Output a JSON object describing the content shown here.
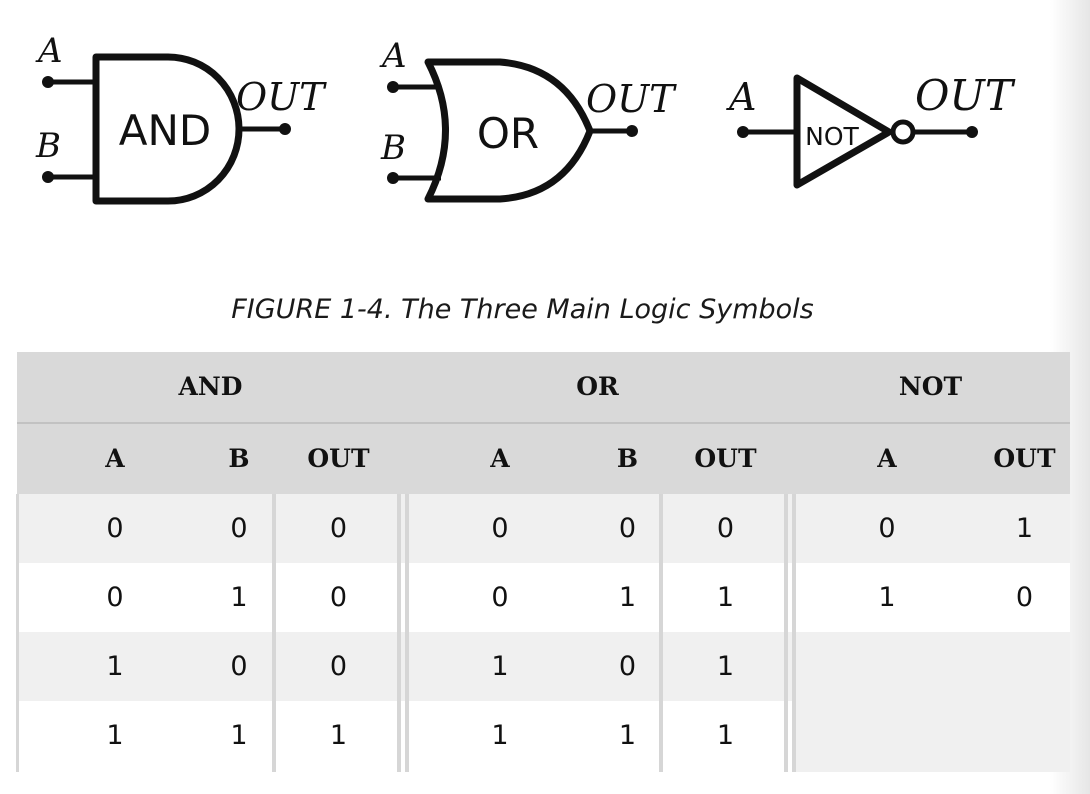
{
  "gates": {
    "and": {
      "label": "AND",
      "input_a": "A",
      "input_b": "B",
      "output": "OUT"
    },
    "or": {
      "label": "OR",
      "input_a": "A",
      "input_b": "B",
      "output": "OUT"
    },
    "not": {
      "label": "NOT",
      "input_a": "A",
      "output": "OUT"
    }
  },
  "caption": "FIGURE 1-4. The Three Main Logic Symbols",
  "table": {
    "groups": [
      "AND",
      "OR",
      "NOT"
    ],
    "and": {
      "columns": [
        "A",
        "B",
        "OUT"
      ],
      "rows": [
        [
          "0",
          "0",
          "0"
        ],
        [
          "0",
          "1",
          "0"
        ],
        [
          "1",
          "0",
          "0"
        ],
        [
          "1",
          "1",
          "1"
        ]
      ]
    },
    "or": {
      "columns": [
        "A",
        "B",
        "OUT"
      ],
      "rows": [
        [
          "0",
          "0",
          "0"
        ],
        [
          "0",
          "1",
          "1"
        ],
        [
          "1",
          "0",
          "1"
        ],
        [
          "1",
          "1",
          "1"
        ]
      ]
    },
    "not": {
      "columns": [
        "A",
        "OUT"
      ],
      "rows": [
        [
          "0",
          "1"
        ],
        [
          "1",
          "0"
        ]
      ]
    }
  }
}
